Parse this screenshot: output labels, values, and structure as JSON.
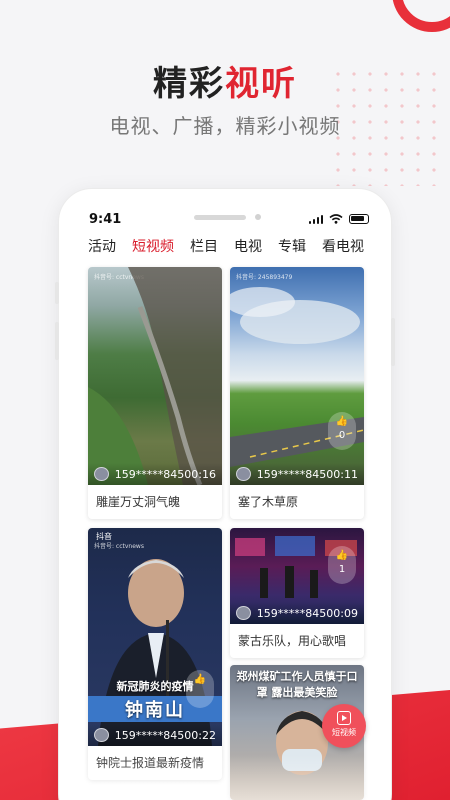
{
  "header": {
    "title_part1": "精彩",
    "title_part2": "视听",
    "subtitle": "电视、广播，精彩小视频",
    "accent_color": "#e02531"
  },
  "status_bar": {
    "time": "9:41"
  },
  "tabs": [
    {
      "label": "活动",
      "active": false
    },
    {
      "label": "短视频",
      "active": true
    },
    {
      "label": "栏目",
      "active": false
    },
    {
      "label": "电视",
      "active": false
    },
    {
      "label": "专辑",
      "active": false
    },
    {
      "label": "看电视",
      "active": false
    }
  ],
  "videos": [
    {
      "user": "159*****845",
      "duration": "00:16",
      "caption": "雕崖万丈洞气魄",
      "likes": "",
      "watermark": "抖音号: cctvnews"
    },
    {
      "user": "159*****845",
      "duration": "00:11",
      "caption": "塞了木草原",
      "likes": "0",
      "watermark": "抖音号: 245893479"
    },
    {
      "user": "159*****845",
      "duration": "00:22",
      "caption": "钟院士报道最新疫情",
      "likes": "",
      "watermark": "抖音号: cctvnews",
      "brand": "抖音",
      "overlay": "新冠肺炎的疫情",
      "banner": "钟南山"
    },
    {
      "user": "159*****845",
      "duration": "00:09",
      "caption": "蒙古乐队，用心歌唱",
      "likes": "1"
    },
    {
      "user": "",
      "duration": "",
      "caption": "",
      "overlay": "郑州煤矿工作人员慎于口罩 露出最美笑脸"
    }
  ],
  "float_button": {
    "label": "短视频"
  }
}
